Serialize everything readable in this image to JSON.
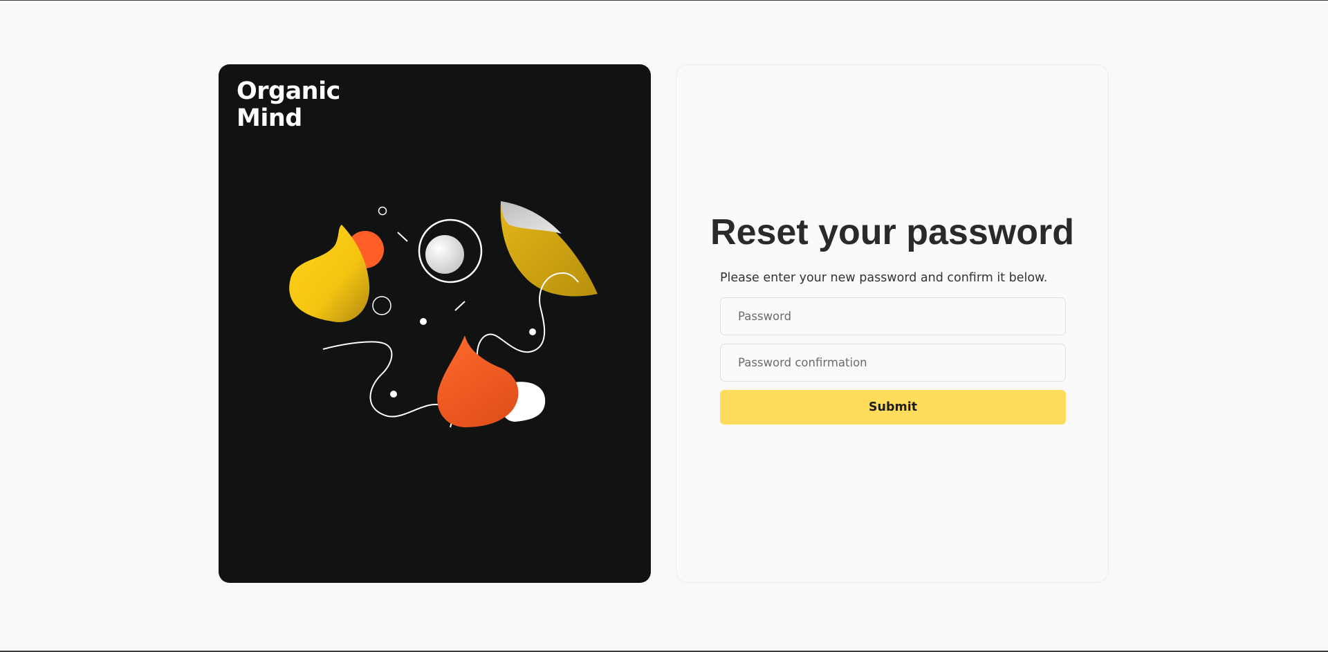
{
  "brand": {
    "line1": "Organic",
    "line2": "Mind"
  },
  "illustration": {
    "icon": "abstract-shapes-illustration",
    "colors": {
      "background": "#111212",
      "yellow": "#f5c41a",
      "orange": "#ff5f2a",
      "white": "#ffffff"
    }
  },
  "form": {
    "title": "Reset your password",
    "subtitle": "Please enter your new password and confirm it below.",
    "password_placeholder": "Password",
    "confirmation_placeholder": "Password confirmation",
    "submit_label": "Submit",
    "accent_color": "#ffdc5c"
  }
}
